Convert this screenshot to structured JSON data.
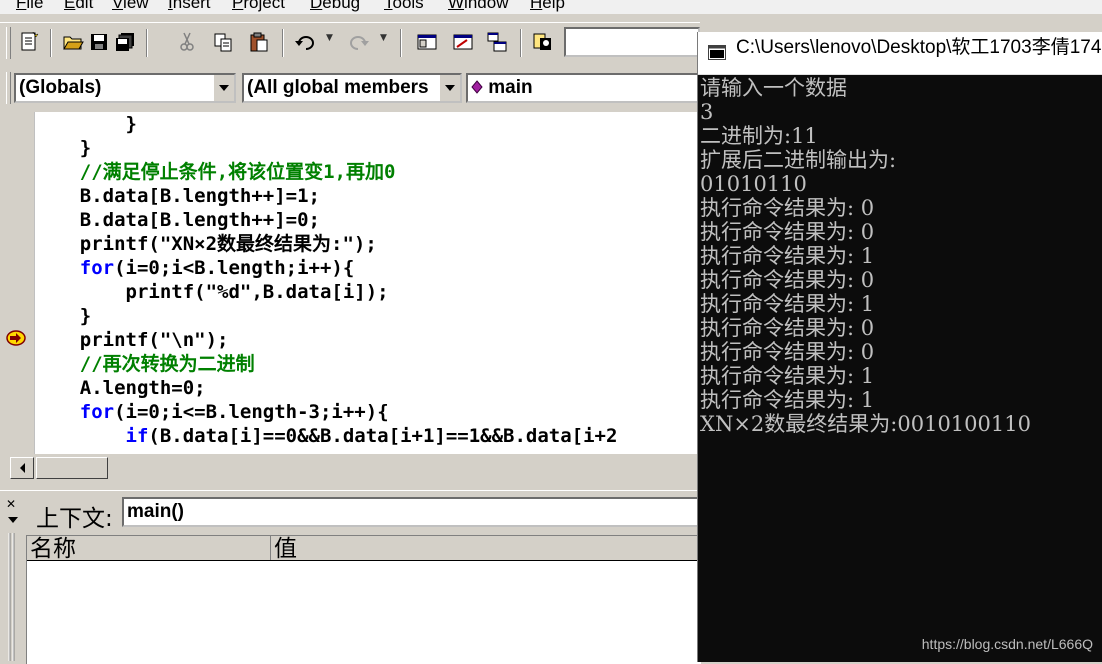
{
  "menu": {
    "items": [
      {
        "first": "F",
        "rest": "ile"
      },
      {
        "first": "E",
        "rest": "dit"
      },
      {
        "first": "V",
        "rest": "iew"
      },
      {
        "first": "I",
        "rest": "nsert"
      },
      {
        "first": "P",
        "rest": "roject"
      },
      {
        "first": "D",
        "rest": "ebug"
      },
      {
        "first": "T",
        "rest": "ools"
      },
      {
        "first": "W",
        "rest": "indow"
      },
      {
        "first": "H",
        "rest": "elp"
      }
    ]
  },
  "toolbar": {
    "icons": [
      "new-text-file-icon",
      "open-folder-icon",
      "save-icon",
      "save-all-icon",
      "cut-icon",
      "copy-icon",
      "paste-icon",
      "undo-icon",
      "redo-icon",
      "workspace-icon",
      "output-icon",
      "window-list-icon",
      "find-in-files-icon"
    ],
    "find_value": ""
  },
  "wizard": {
    "class_combo": "(Globals)",
    "members_combo": "(All global members",
    "function_combo": "main"
  },
  "editor": {
    "lines": [
      {
        "indent": "        ",
        "parts": [
          {
            "t": "}",
            "c": "n"
          }
        ]
      },
      {
        "indent": "    ",
        "parts": [
          {
            "t": "}",
            "c": "n"
          }
        ]
      },
      {
        "indent": "    ",
        "parts": [
          {
            "t": "//满足停止条件,将该位置变1,再加0",
            "c": "cm"
          }
        ]
      },
      {
        "indent": "    ",
        "parts": [
          {
            "t": "B.data[B.length++]=1;",
            "c": "n"
          }
        ]
      },
      {
        "indent": "    ",
        "parts": [
          {
            "t": "B.data[B.length++]=0;",
            "c": "n"
          }
        ]
      },
      {
        "indent": "    ",
        "parts": [
          {
            "t": "printf(\"XN×2数最终结果为:\");",
            "c": "n"
          }
        ]
      },
      {
        "indent": "    ",
        "parts": [
          {
            "t": "for",
            "c": "kw"
          },
          {
            "t": "(i=0;i<B.length;i++){",
            "c": "n"
          }
        ]
      },
      {
        "indent": "        ",
        "parts": [
          {
            "t": "printf(\"%d\",B.data[i]);",
            "c": "n"
          }
        ]
      },
      {
        "indent": "    ",
        "parts": [
          {
            "t": "}",
            "c": "n"
          }
        ]
      },
      {
        "indent": "    ",
        "parts": [
          {
            "t": "printf(\"\\n\");",
            "c": "n"
          }
        ]
      },
      {
        "indent": "    ",
        "parts": [
          {
            "t": "//再次转换为二进制",
            "c": "cm"
          }
        ]
      },
      {
        "indent": "    ",
        "parts": [
          {
            "t": "A.length=0;",
            "c": "n"
          }
        ]
      },
      {
        "indent": "    ",
        "parts": [
          {
            "t": "for",
            "c": "kw"
          },
          {
            "t": "(i=0;i<=B.length-3;i++){",
            "c": "n"
          }
        ]
      },
      {
        "indent": "        ",
        "parts": [
          {
            "t": "if",
            "c": "kw"
          },
          {
            "t": "(B.data[i]==0&&B.data[i+1]==1&&B.data[i+2",
            "c": "n"
          }
        ]
      }
    ]
  },
  "variables": {
    "context_label": "上下文:",
    "context_value": "main()",
    "col_name": "名称",
    "col_value": "值"
  },
  "console": {
    "title": "C:\\Users\\lenovo\\Desktop\\软工1703李倩174",
    "lines": [
      "请输入一个数据",
      "3",
      "二进制为:11",
      "扩展后二进制输出为:",
      "01010110",
      "执行命令结果为: 0",
      "执行命令结果为: 0",
      "执行命令结果为: 1",
      "执行命令结果为: 0",
      "执行命令结果为: 1",
      "执行命令结果为: 0",
      "执行命令结果为: 0",
      "执行命令结果为: 1",
      "执行命令结果为: 1",
      "XN×2数最终结果为:0010100110"
    ],
    "watermark": "https://blog.csdn.net/L666Q"
  }
}
